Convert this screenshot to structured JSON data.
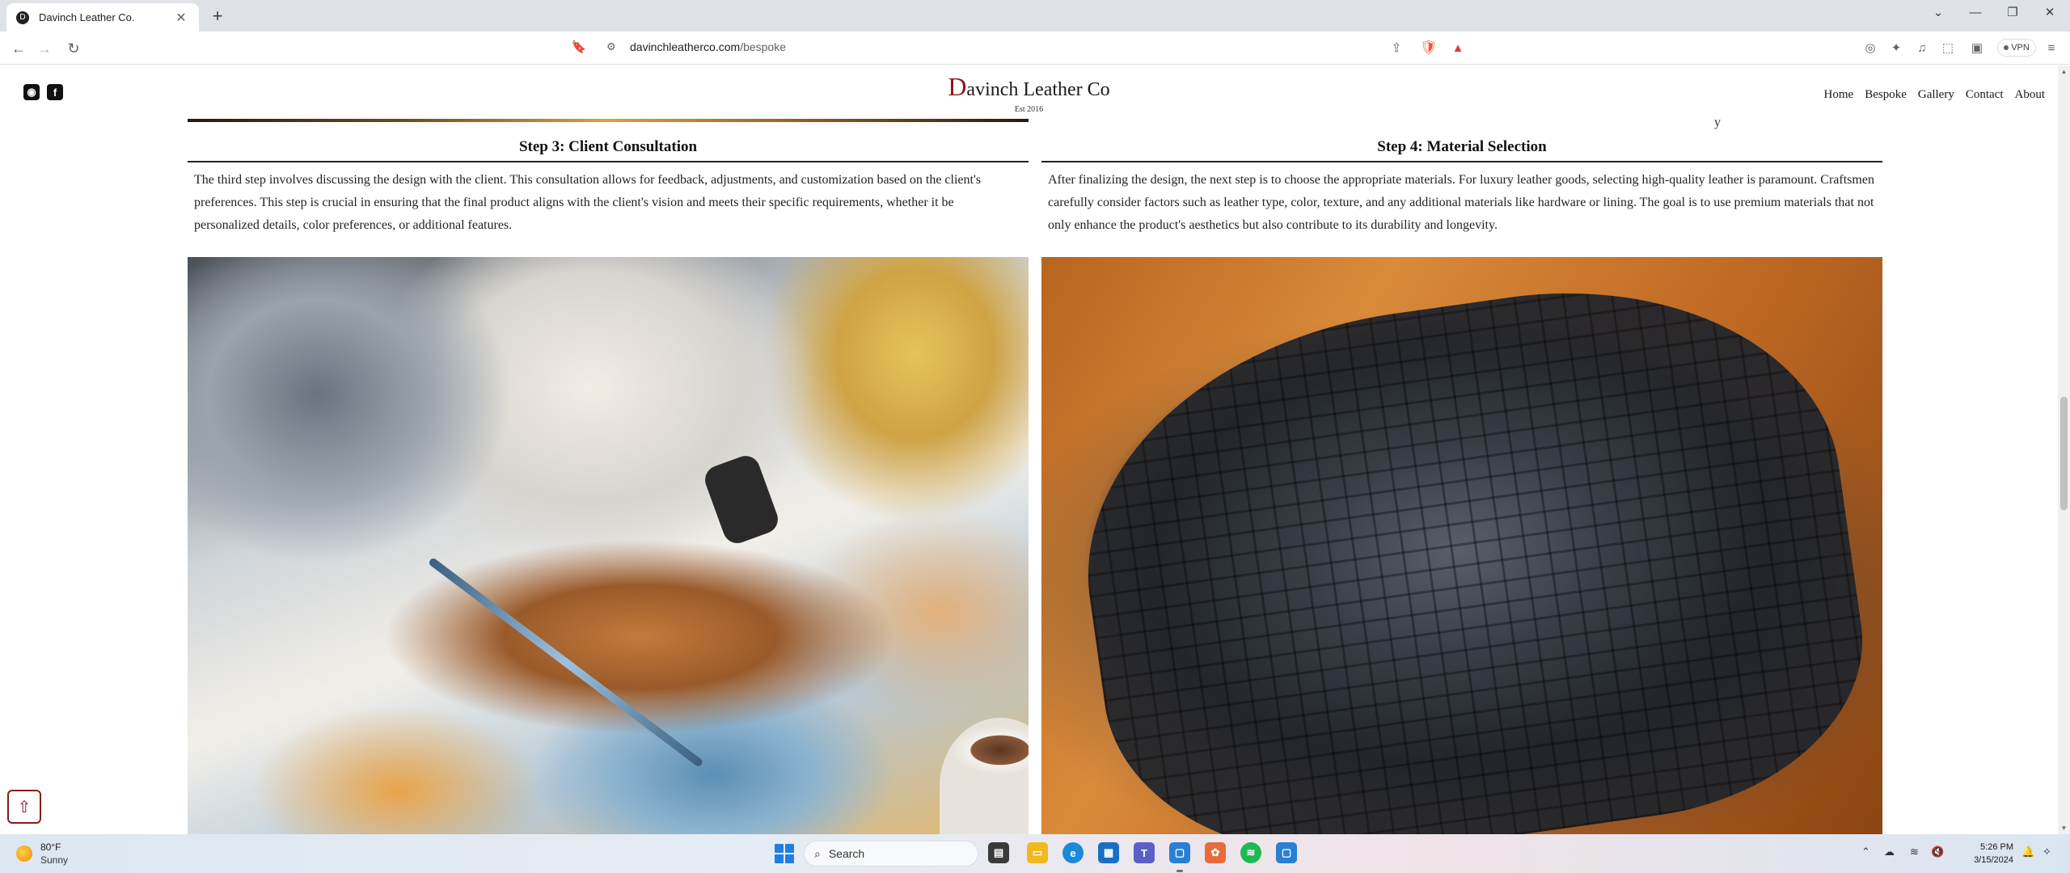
{
  "browser": {
    "tab_title": "Davinch Leather Co.",
    "tab_favicon": "D",
    "url_domain": "davinchleatherco.com",
    "url_path": "/bespoke",
    "vpn_label": "VPN"
  },
  "header": {
    "logo_initial": "D",
    "logo_rest": "avinch Leather Co",
    "logo_est": "Est 2016",
    "nav": [
      "Home",
      "Bespoke",
      "Gallery",
      "Contact",
      "About"
    ]
  },
  "steps": [
    {
      "title": "Step 3: Client Consultation",
      "text": "The third step involves discussing the design with the client. This consultation allows for feedback, adjustments, and customization based on the client's preferences. This step is crucial in ensuring that the final product aligns with the client's vision and meets their specific requirements, whether it be personalized details, color preferences, or additional features."
    },
    {
      "title": "Step 4: Material Selection",
      "text": "After finalizing the design, the next step is to choose the appropriate materials. For luxury leather goods, selecting high-quality leather is paramount. Craftsmen carefully consider factors such as leather type, color, texture, and any additional materials like hardware or lining. The goal is to use premium materials that not only enhance the product's aesthetics but also contribute to its durability and longevity."
    }
  ],
  "prev_right_fragment": "y",
  "taskbar": {
    "weather_temp": "80°F",
    "weather_cond": "Sunny",
    "search_label": "Search",
    "time": "5:26 PM",
    "date": "3/15/2024"
  }
}
